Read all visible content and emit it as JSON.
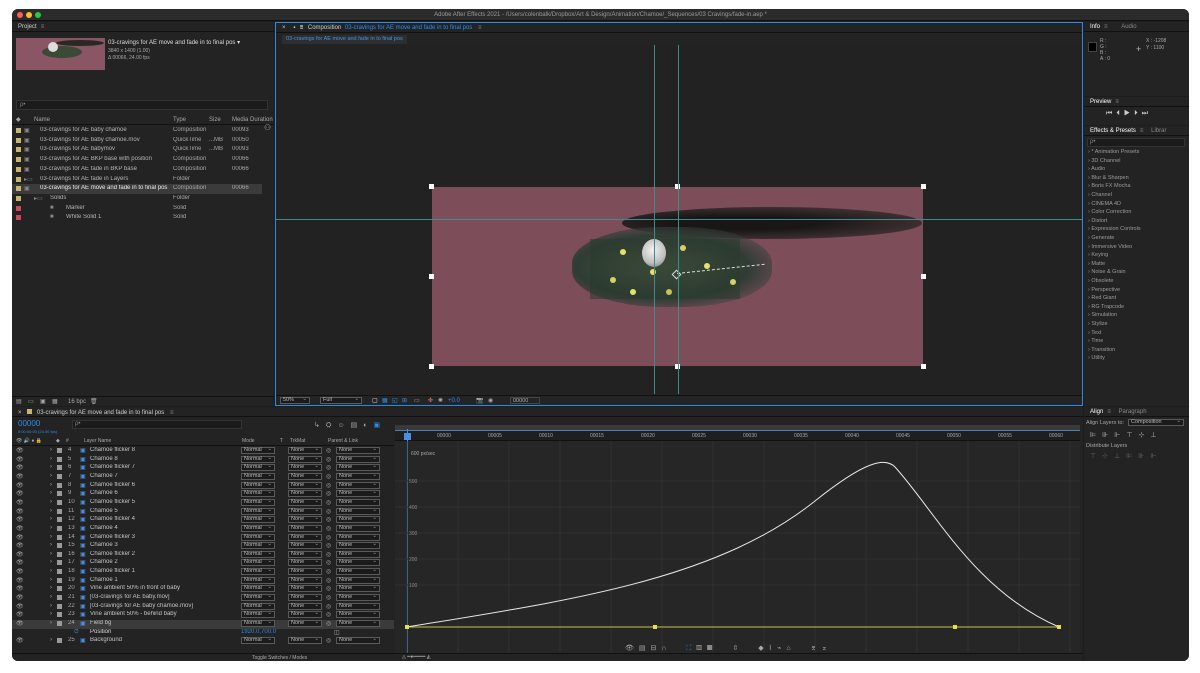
{
  "window": {
    "title": "Adobe After Effects 2021 - /Users/colenbalk/Dropbox/Art & Design/Animation/Chamoe/_Sequences/03 Cravings/fade-in.aep *"
  },
  "project": {
    "title": "Project",
    "selected_name": "03-cravings for AE move and fade in to final pos ▾",
    "selected_info1": "3840 x 1400 (1.00)",
    "selected_info2": "Δ 00066, 24.00 fps",
    "search_placeholder": "ρ•",
    "columns": {
      "name": "Name",
      "type": "Type",
      "size": "Size",
      "duration": "Media Duration"
    },
    "items": [
      {
        "name": "03-cravings for AE baby chamoe",
        "type": "Composition",
        "size": "",
        "duration": "00093",
        "color": "#c8b46a",
        "kind": "comp"
      },
      {
        "name": "03-cravings for AE baby chamoe.mov",
        "type": "QuickTime",
        "size": "...MB",
        "duration": "00050",
        "color": "#c8b46a",
        "kind": "footage"
      },
      {
        "name": "03-cravings for AE babymov",
        "type": "QuickTime",
        "size": "...MB",
        "duration": "00093",
        "color": "#c8b46a",
        "kind": "footage"
      },
      {
        "name": "03-cravings for AE BKP base with position",
        "type": "Composition",
        "size": "",
        "duration": "00066",
        "color": "#c8b46a",
        "kind": "comp"
      },
      {
        "name": "03-cravings for AE fade in BKP base",
        "type": "Composition",
        "size": "",
        "duration": "00066",
        "color": "#c8b46a",
        "kind": "comp"
      },
      {
        "name": "03-cravings for AE fade in Layers",
        "type": "Folder",
        "size": "",
        "duration": "",
        "color": "#c8b46a",
        "kind": "folder"
      },
      {
        "name": "03-cravings for AE move and fade in to final pos",
        "type": "Composition",
        "size": "",
        "duration": "00066",
        "color": "#c8b46a",
        "kind": "comp"
      },
      {
        "name": "Solids",
        "type": "Folder",
        "size": "",
        "duration": "",
        "color": "#c8b46a",
        "kind": "folder"
      },
      {
        "name": "Marker",
        "type": "Solid",
        "size": "",
        "duration": "",
        "color": "#c9485a",
        "kind": "solid"
      },
      {
        "name": "White Solid 1",
        "type": "Solid",
        "size": "",
        "duration": "",
        "color": "#c9485a",
        "kind": "solid"
      }
    ],
    "bpc": "16 bpc"
  },
  "composition": {
    "title": "Composition",
    "comp_name": "03-cravings for AE move and fade in to final pos",
    "tab": "03-cravings for AE move and fade in to final pos",
    "zoom": "50%",
    "resolution": "Full",
    "exposure": "+0.0",
    "timecode": "00000"
  },
  "info": {
    "tab_info": "Info",
    "tab_audio": "Audio",
    "r": "R :",
    "g": "G :",
    "b": "B :",
    "a": "A :  0",
    "x": "X : -1208",
    "y": "Y : 1100"
  },
  "preview": {
    "title": "Preview"
  },
  "effects": {
    "tab": "Effects & Presets",
    "tab_library": "Librar",
    "items": [
      "* Animation Presets",
      "3D Channel",
      "Audio",
      "Blur & Sharpen",
      "Boris FX Mocha",
      "Channel",
      "CINEMA 4D",
      "Color Correction",
      "Distort",
      "Expression Controls",
      "Generate",
      "Immersive Video",
      "Keying",
      "Matte",
      "Noise & Grain",
      "Obsolete",
      "Perspective",
      "Red Giant",
      "RG Trapcode",
      "Simulation",
      "Stylize",
      "Text",
      "Time",
      "Transition",
      "Utility"
    ]
  },
  "align": {
    "tab": "Align",
    "tab_paragraph": "Paragraph",
    "align_to_label": "Align Layers to:",
    "align_to_value": "Composition",
    "distribute_label": "Distribute Layers"
  },
  "timeline": {
    "comp_tab": "03-cravings for AE move and fade in to final pos",
    "timecode": "00000",
    "timecode_sub": "0:00:00:00 (24.00 fps)",
    "columns": {
      "layer_name": "Layer Name",
      "mode": "Mode",
      "t": "T",
      "trkmat": "TrkMat",
      "parent": "Parent & Link"
    },
    "layers": [
      {
        "num": "4",
        "name": "Chamoe flicker 8",
        "mode": "Normal",
        "trk": "None",
        "parent": "None"
      },
      {
        "num": "5",
        "name": "Chamoe 8",
        "mode": "Normal",
        "trk": "None",
        "parent": "None"
      },
      {
        "num": "6",
        "name": "Chamoe flicker 7",
        "mode": "Normal",
        "trk": "None",
        "parent": "None"
      },
      {
        "num": "7",
        "name": "Chamoe 7",
        "mode": "Normal",
        "trk": "None",
        "parent": "None"
      },
      {
        "num": "8",
        "name": "Chamoe flicker 6",
        "mode": "Normal",
        "trk": "None",
        "parent": "None"
      },
      {
        "num": "9",
        "name": "Chamoe 6",
        "mode": "Normal",
        "trk": "None",
        "parent": "None"
      },
      {
        "num": "10",
        "name": "Chamoe flicker 5",
        "mode": "Normal",
        "trk": "None",
        "parent": "None"
      },
      {
        "num": "11",
        "name": "Chamoe 5",
        "mode": "Normal",
        "trk": "None",
        "parent": "None"
      },
      {
        "num": "12",
        "name": "Chamoe flicker 4",
        "mode": "Normal",
        "trk": "None",
        "parent": "None"
      },
      {
        "num": "13",
        "name": "Chamoe 4",
        "mode": "Normal",
        "trk": "None",
        "parent": "None"
      },
      {
        "num": "14",
        "name": "Chamoe flicker 3",
        "mode": "Normal",
        "trk": "None",
        "parent": "None"
      },
      {
        "num": "15",
        "name": "Chamoe 3",
        "mode": "Normal",
        "trk": "None",
        "parent": "None"
      },
      {
        "num": "16",
        "name": "Chamoe flicker 2",
        "mode": "Normal",
        "trk": "None",
        "parent": "None"
      },
      {
        "num": "17",
        "name": "Chamoe 2",
        "mode": "Normal",
        "trk": "None",
        "parent": "None"
      },
      {
        "num": "18",
        "name": "Chamoe flicker 1",
        "mode": "Normal",
        "trk": "None",
        "parent": "None"
      },
      {
        "num": "19",
        "name": "Chamoe 1",
        "mode": "Normal",
        "trk": "None",
        "parent": "None"
      },
      {
        "num": "20",
        "name": "Vine ambient 50% in front of baby",
        "mode": "Normal",
        "trk": "None",
        "parent": "None"
      },
      {
        "num": "21",
        "name": "[03-cravings for AE baby.mov]",
        "mode": "Normal",
        "trk": "None",
        "parent": "None"
      },
      {
        "num": "22",
        "name": "[03-cravings for AE baby chamoe.mov]",
        "mode": "Normal",
        "trk": "None",
        "parent": "None"
      },
      {
        "num": "23",
        "name": "Vine ambient 50% - behind baby",
        "mode": "Normal",
        "trk": "None",
        "parent": "None"
      },
      {
        "num": "24",
        "name": "Field bg",
        "mode": "Normal",
        "trk": "None",
        "parent": "None"
      }
    ],
    "position_label": "Position",
    "position_value": "1920.0,700.0",
    "last_layer": {
      "num": "25",
      "name": "Background",
      "mode": "Normal",
      "trk": "None",
      "parent": "None"
    },
    "toggle_label": "Toggle Switches / Modes",
    "ruler": [
      "00000",
      "00005",
      "00010",
      "00015",
      "00020",
      "00025",
      "00030",
      "00035",
      "00040",
      "00045",
      "00050",
      "00055",
      "00060",
      "00065"
    ],
    "graph_unit": "600 px/sec",
    "graph_ticks": [
      "500",
      "400",
      "300",
      "200",
      "100"
    ]
  }
}
